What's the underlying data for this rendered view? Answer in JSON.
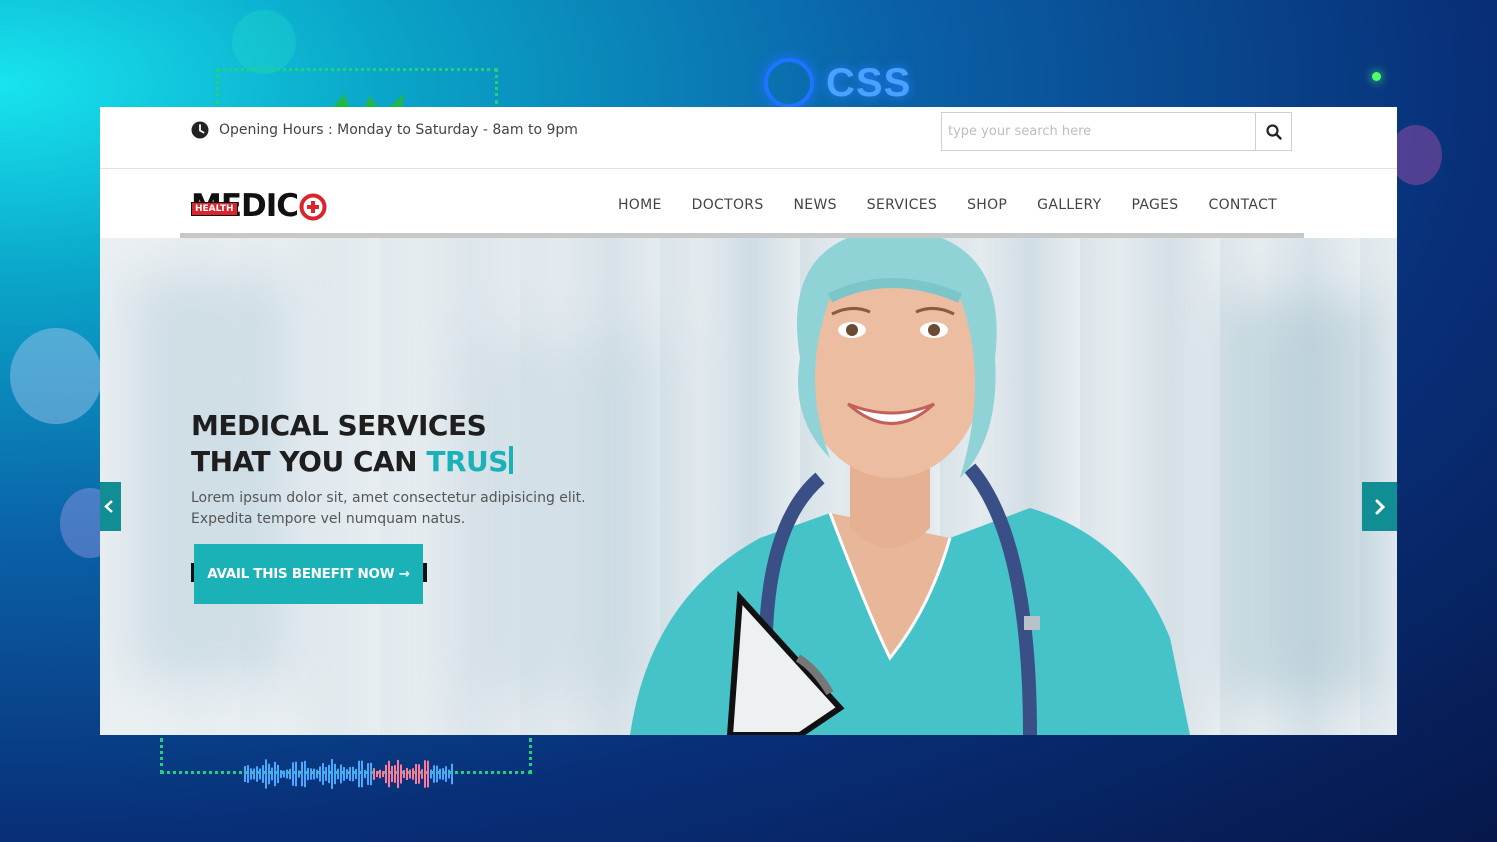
{
  "background": {
    "badge_text": "CSS"
  },
  "topbar": {
    "hours_text": "Opening Hours : Monday to Saturday - 8am to 9pm",
    "search_placeholder": "type your search here"
  },
  "logo": {
    "word": "MEDIC",
    "badge": "HEALTH"
  },
  "nav": {
    "items": [
      {
        "label": "HOME"
      },
      {
        "label": "DOCTORS"
      },
      {
        "label": "NEWS"
      },
      {
        "label": "SERVICES"
      },
      {
        "label": "SHOP"
      },
      {
        "label": "GALLERY"
      },
      {
        "label": "PAGES"
      },
      {
        "label": "CONTACT"
      }
    ]
  },
  "hero": {
    "title_line1": "MEDICAL SERVICES",
    "title_line2_prefix": "THAT YOU CAN ",
    "title_line2_typed": "TRUS",
    "subtitle": "Lorem ipsum dolor sit, amet consectetur adipisicing elit. Expedita tempore vel numquam natus.",
    "cta_label": "AVAIL THIS BENEFIT NOW →"
  },
  "colors": {
    "accent": "#1bb2b7",
    "accent_dark": "#118e93",
    "logo_red": "#d9252b",
    "text_dark": "#1e1e1e"
  },
  "icons": [
    "clock-icon",
    "search-icon",
    "plus-circle-icon",
    "chevron-left-icon",
    "chevron-right-icon",
    "css-ring-icon"
  ]
}
